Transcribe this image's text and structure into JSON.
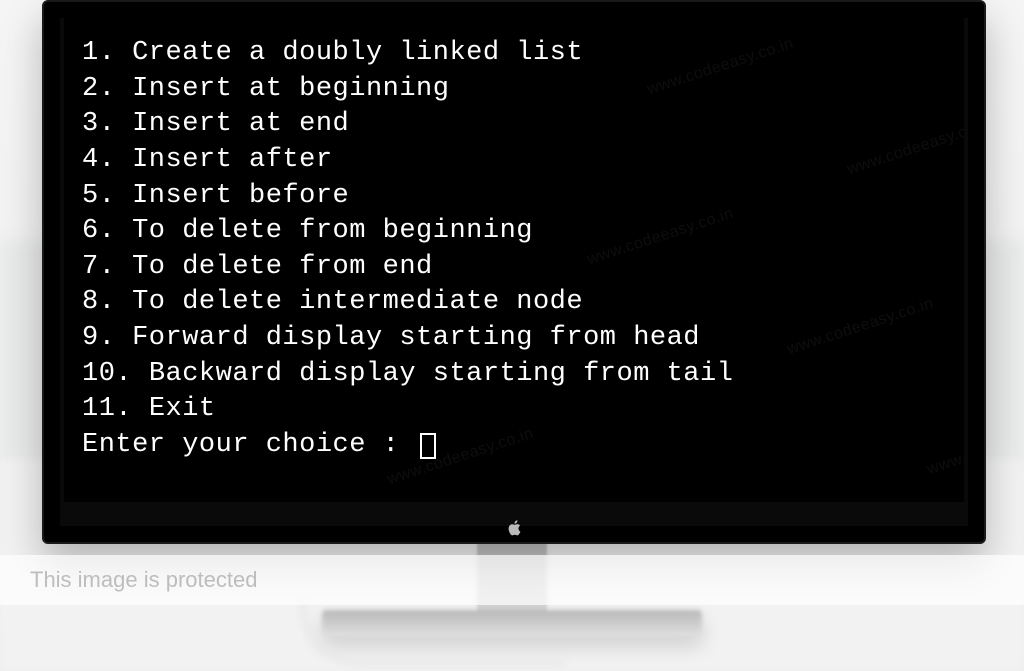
{
  "terminal": {
    "menu": [
      {
        "num": "1.",
        "text": "Create a doubly linked list"
      },
      {
        "num": "2.",
        "text": "Insert at beginning"
      },
      {
        "num": "3.",
        "text": "Insert at end"
      },
      {
        "num": "4.",
        "text": "Insert after"
      },
      {
        "num": "5.",
        "text": "Insert before"
      },
      {
        "num": "6.",
        "text": "To delete from beginning"
      },
      {
        "num": "7.",
        "text": "To delete from end"
      },
      {
        "num": "8.",
        "text": "To delete intermediate node"
      },
      {
        "num": "9.",
        "text": "Forward display starting from head"
      },
      {
        "num": "10.",
        "text": "Backward display starting from tail"
      },
      {
        "num": "11.",
        "text": "Exit"
      }
    ],
    "prompt": "Enter your choice : ",
    "input_value": ""
  },
  "watermark_text": "www.codeeasy.co.in",
  "overlay_text": "This image is protected"
}
